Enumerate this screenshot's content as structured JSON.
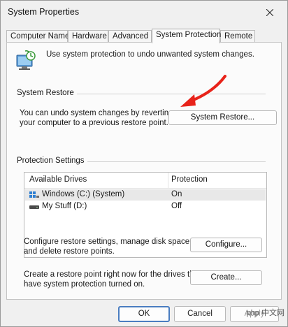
{
  "window": {
    "title": "System Properties"
  },
  "tabs": [
    {
      "label": "Computer Name"
    },
    {
      "label": "Hardware"
    },
    {
      "label": "Advanced"
    },
    {
      "label": "System Protection"
    },
    {
      "label": "Remote"
    }
  ],
  "active_tab": "System Protection",
  "intro": {
    "text": "Use system protection to undo unwanted system changes."
  },
  "system_restore": {
    "section_label": "System Restore",
    "description_line1": "You can undo system changes by reverting",
    "description_line2": "your computer to a previous restore point.",
    "button_label": "System Restore..."
  },
  "protection_settings": {
    "section_label": "Protection Settings",
    "columns": [
      "Available Drives",
      "Protection"
    ],
    "drives": [
      {
        "name": "Windows (C:) (System)",
        "protection": "On",
        "icon": "windows-drive-icon"
      },
      {
        "name": "My Stuff (D:)",
        "protection": "Off",
        "icon": "drive-icon"
      }
    ]
  },
  "configure": {
    "text_line1": "Configure restore settings, manage disk space,",
    "text_line2": "and delete restore points.",
    "button_label": "Configure..."
  },
  "create": {
    "text_line1": "Create a restore point right now for the drives that",
    "text_line2": "have system protection turned on.",
    "button_label": "Create..."
  },
  "footer": {
    "ok_label": "OK",
    "cancel_label": "Cancel",
    "apply_label": "Apply"
  },
  "watermark": {
    "text": "php 中文网"
  },
  "colors": {
    "annotation_arrow": "#e8231a",
    "default_button_border": "#4a7dc0"
  }
}
